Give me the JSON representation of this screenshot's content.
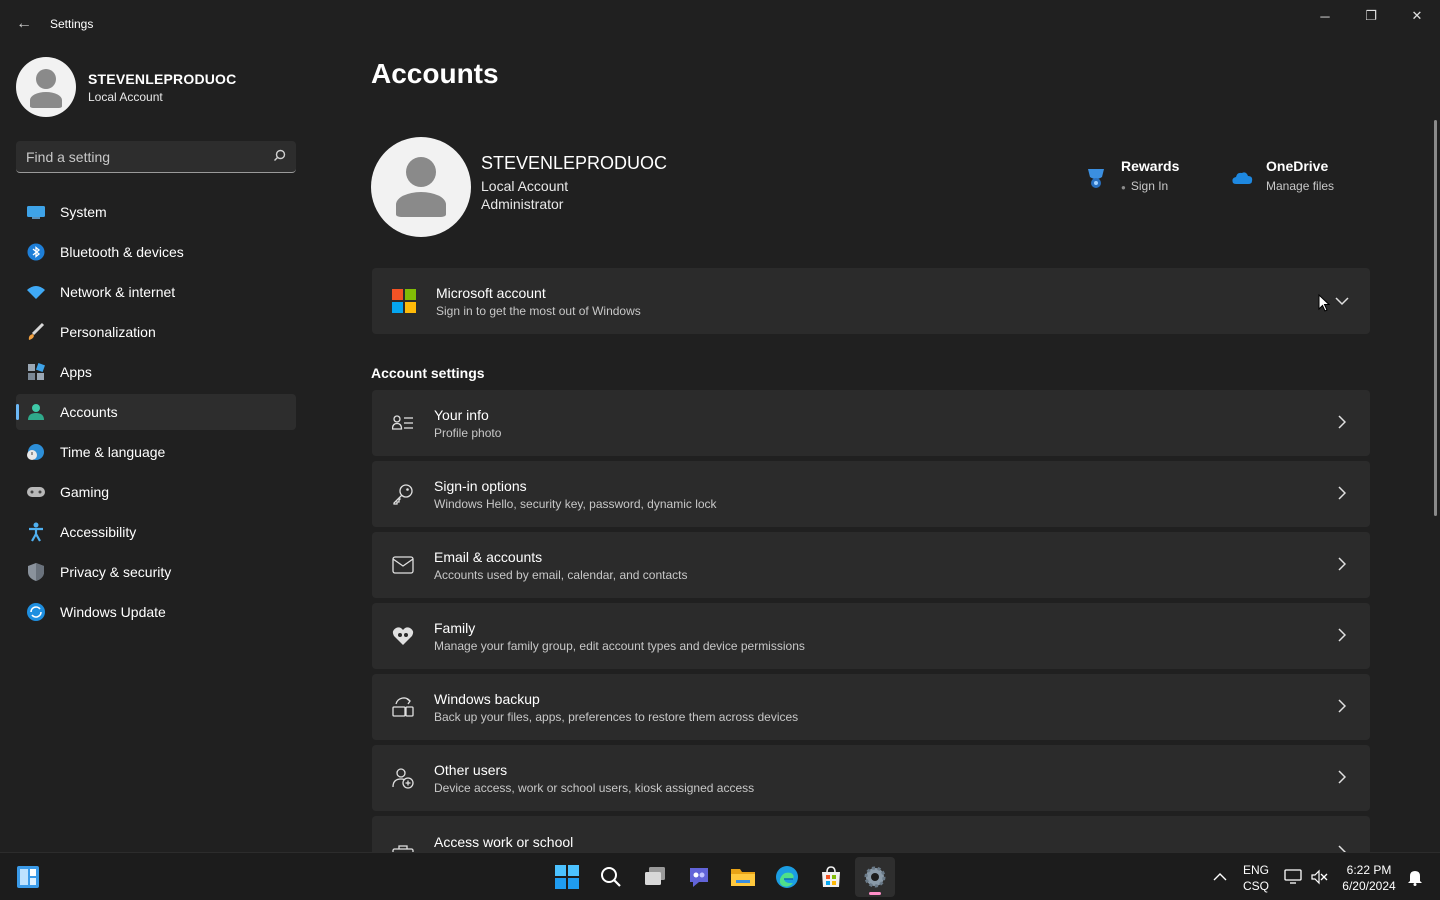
{
  "window": {
    "title": "Settings",
    "back_glyph": "←",
    "minimize_glyph": "─",
    "maximize_glyph": "❐",
    "close_glyph": "✕"
  },
  "profile": {
    "name": "STEVENLEPRODUOC",
    "account_type": "Local Account"
  },
  "search": {
    "placeholder": "Find a setting",
    "icon": "search-icon"
  },
  "sidebar": {
    "items": [
      {
        "label": "System",
        "icon": "system-icon"
      },
      {
        "label": "Bluetooth & devices",
        "icon": "bluetooth-icon"
      },
      {
        "label": "Network & internet",
        "icon": "wifi-icon"
      },
      {
        "label": "Personalization",
        "icon": "brush-icon"
      },
      {
        "label": "Apps",
        "icon": "apps-icon"
      },
      {
        "label": "Accounts",
        "icon": "accounts-icon",
        "active": true
      },
      {
        "label": "Time & language",
        "icon": "globe-clock-icon"
      },
      {
        "label": "Gaming",
        "icon": "gamepad-icon"
      },
      {
        "label": "Accessibility",
        "icon": "accessibility-icon"
      },
      {
        "label": "Privacy & security",
        "icon": "shield-icon"
      },
      {
        "label": "Windows Update",
        "icon": "update-icon"
      }
    ]
  },
  "main": {
    "title": "Accounts",
    "hero": {
      "name": "STEVENLEPRODUOC",
      "line1": "Local Account",
      "line2": "Administrator"
    },
    "rewards": {
      "title": "Rewards",
      "sub": "Sign In"
    },
    "onedrive": {
      "title": "OneDrive",
      "sub": "Manage files"
    },
    "microsoft_account": {
      "title": "Microsoft account",
      "sub": "Sign in to get the most out of Windows"
    },
    "section_title": "Account settings",
    "cards": [
      {
        "title": "Your info",
        "sub": "Profile photo",
        "icon": "contact-card-icon"
      },
      {
        "title": "Sign-in options",
        "sub": "Windows Hello, security key, password, dynamic lock",
        "icon": "key-icon"
      },
      {
        "title": "Email & accounts",
        "sub": "Accounts used by email, calendar, and contacts",
        "icon": "mail-icon"
      },
      {
        "title": "Family",
        "sub": "Manage your family group, edit account types and device permissions",
        "icon": "family-heart-icon"
      },
      {
        "title": "Windows backup",
        "sub": "Back up your files, apps, preferences to restore them across devices",
        "icon": "backup-icon"
      },
      {
        "title": "Other users",
        "sub": "Device access, work or school users, kiosk assigned access",
        "icon": "add-user-icon"
      },
      {
        "title": "Access work or school",
        "sub": "",
        "icon": "briefcase-icon"
      }
    ]
  },
  "taskbar": {
    "apps": [
      "widgets-icon",
      "start-icon",
      "search-icon",
      "task-view-icon",
      "teams-chat-icon",
      "file-explorer-icon",
      "edge-icon",
      "store-icon",
      "settings-icon"
    ],
    "tray": {
      "lang_top": "ENG",
      "lang_bottom": "CSQ",
      "time": "6:22 PM",
      "date": "6/20/2024"
    }
  },
  "colors": {
    "accent": "#6cb8f6",
    "background": "#202020",
    "card": "#2b2b2b"
  }
}
